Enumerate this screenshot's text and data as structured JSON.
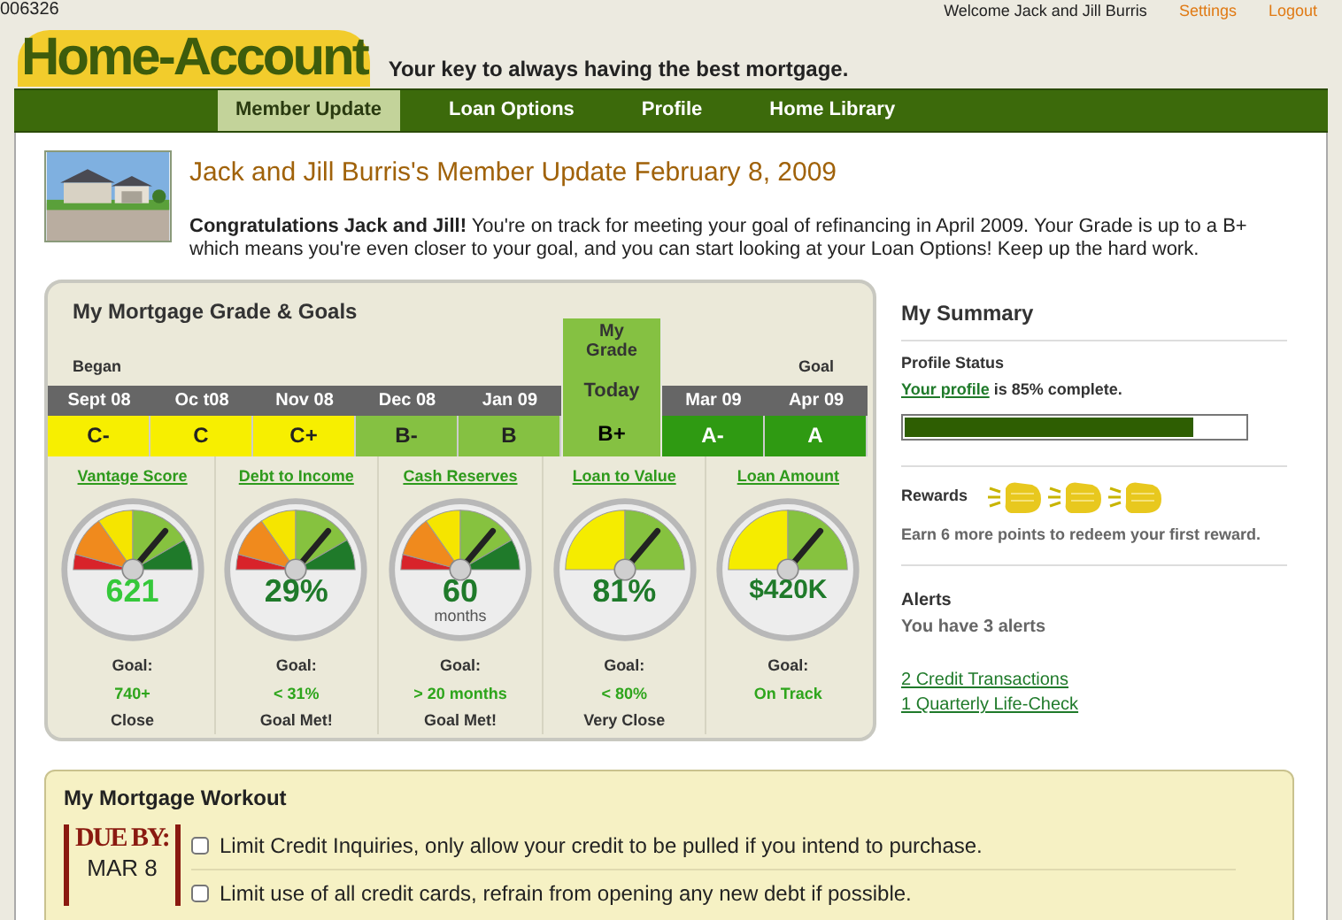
{
  "topbar": {
    "code": "006326",
    "welcome": "Welcome Jack and Jill Burris",
    "links": [
      "Settings",
      "Logout"
    ]
  },
  "header": {
    "logo": "Home-Account",
    "tagline": "Your key to always having the best mortgage."
  },
  "nav": [
    {
      "label": "Member Update",
      "selected": true
    },
    {
      "label": "Loan Options",
      "selected": false
    },
    {
      "label": "Profile",
      "selected": false
    },
    {
      "label": "Home Library",
      "selected": false
    }
  ],
  "update": {
    "title": "Jack and Jill Burris's Member Update February 8, 2009",
    "message": "**Congratulations Jack and Jill!** You're on track for meeting your goal of refinancing in April 2009. Your Grade is up to a B+ which means you're even closer to your goal, and you can start looking at your Loan Options! Keep up the hard work."
  },
  "grade_card": {
    "title": "My Mortgage Grade & Goals",
    "today_label": "My Grade",
    "grades": [
      {
        "above": "Began",
        "month": "Sept 08",
        "grade": "C-",
        "color": "#f7ef00",
        "selected": false
      },
      {
        "month": "Oc t08",
        "grade": "C",
        "color": "#f7ef00",
        "selected": false
      },
      {
        "month": "Nov 08",
        "grade": "C+",
        "color": "#f7ef00",
        "selected": false
      },
      {
        "month": "Dec 08",
        "grade": "B-",
        "color": "#85c142",
        "selected": false
      },
      {
        "month": "Jan 09",
        "grade": "B",
        "color": "#85c142",
        "selected": false
      },
      {
        "month": "Today",
        "grade": "B+",
        "color": "#85c142",
        "selected": true
      },
      {
        "month": "Mar 09",
        "grade": "A-",
        "color": "#2f9a12",
        "selected": false
      },
      {
        "above": "Goal",
        "month": "Apr 09",
        "grade": "A",
        "color": "#2f9a12",
        "selected": false
      }
    ],
    "gauges": [
      {
        "title": "Vantage Score",
        "kind": "five",
        "value": "621",
        "goal_label": "Goal:",
        "goal": "740+",
        "status": "Close"
      },
      {
        "title": "Debt to Income",
        "kind": "five",
        "value": "29%",
        "goal_label": "Goal:",
        "goal": "< 31%",
        "status": "Goal Met!"
      },
      {
        "title": "Cash Reserves",
        "kind": "five",
        "value": "60",
        "unit": "months",
        "goal_label": "Goal:",
        "goal": "> 20 months",
        "status": "Goal Met!"
      },
      {
        "title": "Loan to Value",
        "kind": "two",
        "value": "81%",
        "goal_label": "Goal:",
        "goal": "< 80%",
        "status": "Very Close"
      },
      {
        "title": "Loan Amount",
        "kind": "two",
        "value": "$420K",
        "goal_label": "Goal:",
        "goal": "On Track"
      }
    ]
  },
  "summary": {
    "title": "My Summary",
    "profile_heading": "Profile Status",
    "profile_link": "Your profile",
    "profile_text": "is 85% complete.",
    "progress": {
      "level": 0.85
    },
    "rewards_label": "Rewards",
    "rewards_text": "Earn 6 more points to redeem your first reward.",
    "alerts_heading": "Alerts",
    "alerts_text": "You have 3 alerts",
    "alert_links": [
      "2 Credit Transactions",
      "1 Quarterly Life-Check"
    ]
  },
  "workout": {
    "title": "My Mortgage Workout",
    "due_label": "DUE BY:",
    "due_date": "MAR 8",
    "tasks": [
      {
        "text": "Limit Credit Inquiries, only allow your credit to be pulled if you intend to purchase.",
        "checked": false
      },
      {
        "text": "Limit use of all credit cards, refrain from opening any new debt if possible.",
        "checked": false
      }
    ]
  }
}
